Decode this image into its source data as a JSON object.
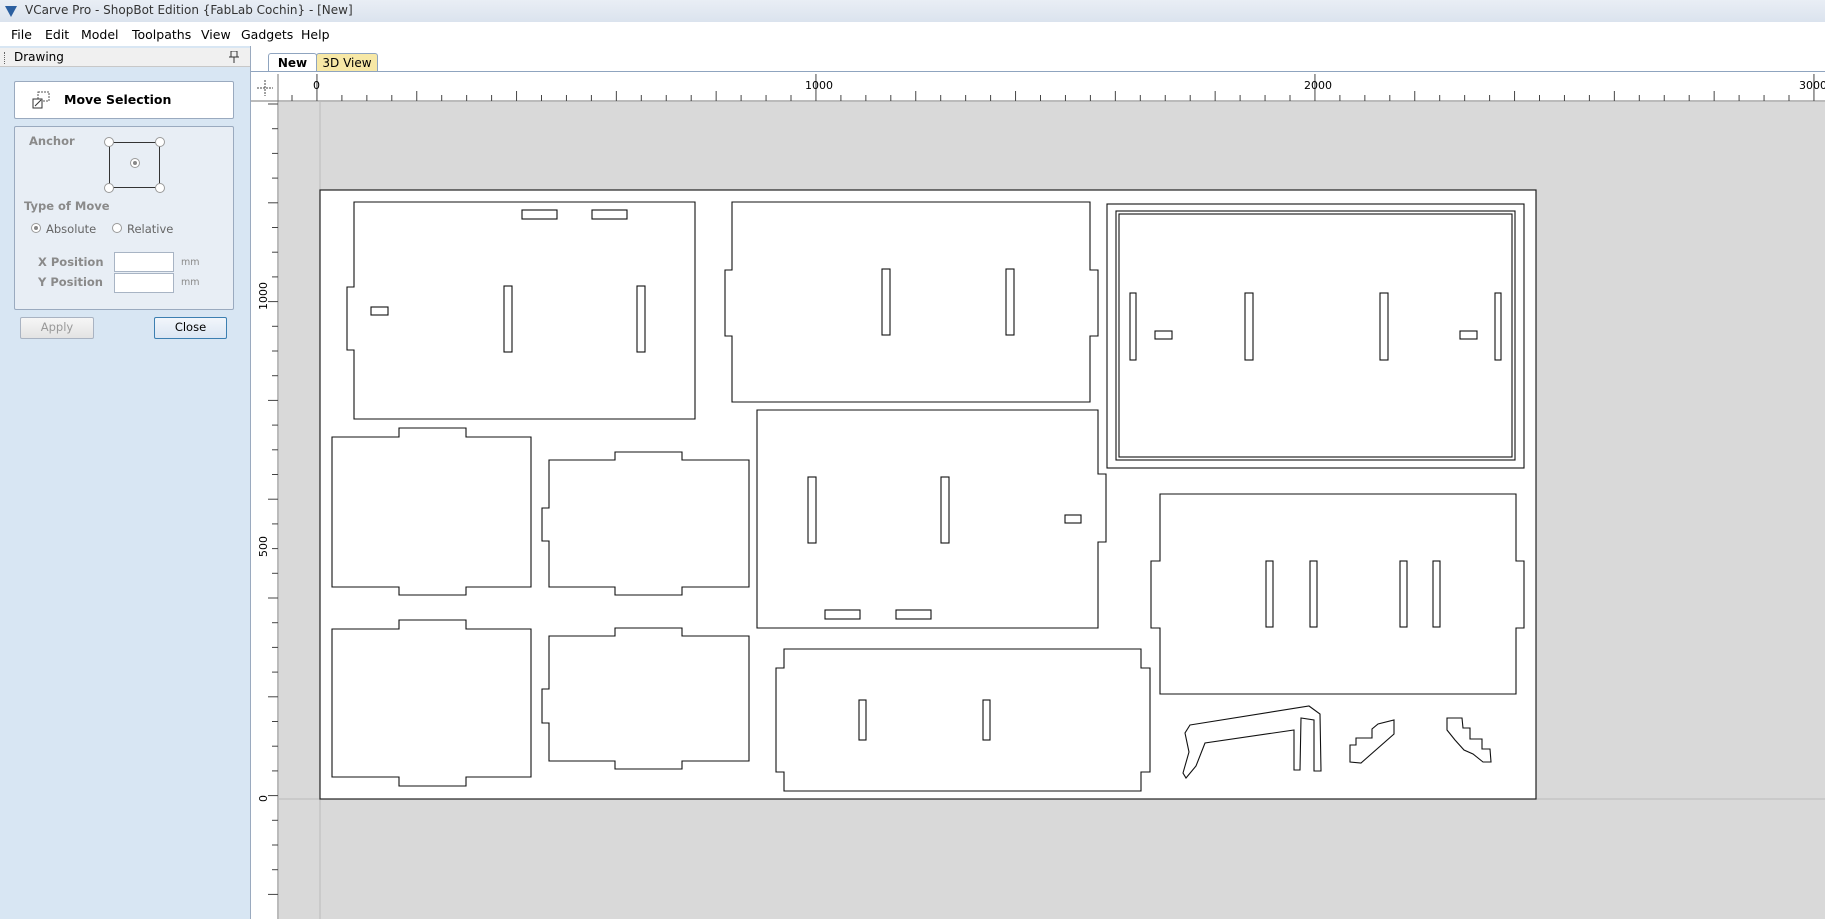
{
  "window": {
    "title": "VCarve Pro - ShopBot Edition {FabLab Cochin} - [New]"
  },
  "menu": [
    "File",
    "Edit",
    "Model",
    "Toolpaths",
    "View",
    "Gadgets",
    "Help"
  ],
  "panel": {
    "header": "Drawing",
    "pin_icon": "pin-icon",
    "tool_title": "Move Selection",
    "anchor_label": "Anchor",
    "type_of_move_label": "Type of Move",
    "absolute_label": "Absolute",
    "relative_label": "Relative",
    "selected_move_type": "Absolute",
    "x_position_label": "X Position",
    "y_position_label": "Y Position",
    "x_position_value": "",
    "y_position_value": "",
    "unit": "mm",
    "apply_label": "Apply",
    "close_label": "Close"
  },
  "tabs": [
    {
      "label": "New",
      "active": true
    },
    {
      "label": "3D View",
      "active": false
    }
  ],
  "rulers": {
    "horizontal_labels": [
      "0",
      "1000",
      "2000",
      "3000"
    ],
    "vertical_labels": [
      "1000",
      "500",
      "0"
    ]
  },
  "colors": {
    "panel_bg": "#d8e6f3",
    "canvas_bg": "#d9d9d9",
    "tab_3d": "#f7e8a6"
  }
}
